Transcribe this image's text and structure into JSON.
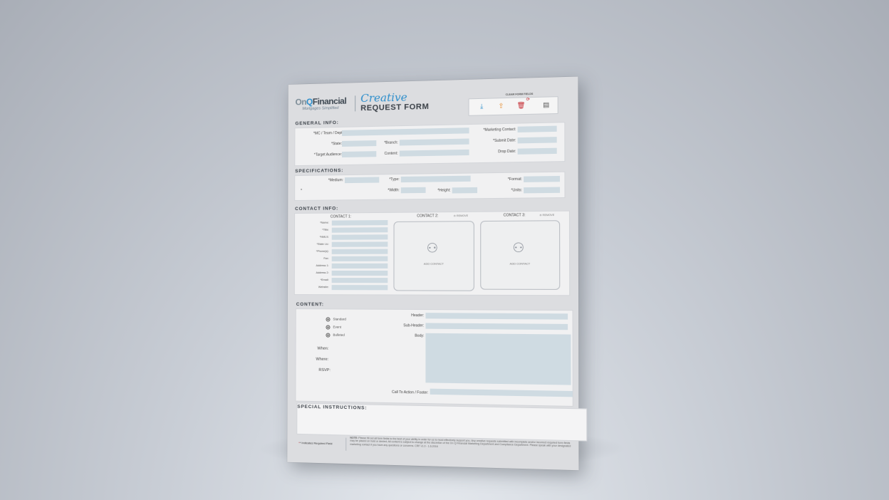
{
  "header": {
    "logo_on": "On",
    "logo_q": "Q",
    "logo_financial": "Financial",
    "logo_tagline": "Mortgages Simplified",
    "title_script": "Creative",
    "title_main": "REQUEST FORM",
    "clear_label": "CLEAR FORM FIELDS"
  },
  "toolbar": {
    "icons": [
      "download-icon",
      "upload-icon",
      "trash-icon",
      "refresh-icon",
      "document-icon"
    ]
  },
  "general": {
    "title": "GENERAL INFO:",
    "mc_label": "*MC / Team / Dept:",
    "state_label": "*State:",
    "branch_label": "*Branch:",
    "audience_label": "*Target Audience:",
    "content_label": "Content:",
    "marketing_label": "*Marketing Contact:",
    "submit_label": "*Submit Date:",
    "drop_label": "Drop Date:"
  },
  "spec": {
    "title": "SPECIFICATIONS:",
    "medium_label": "*Medium:",
    "type_label": "*Type:",
    "format_label": "*Format:",
    "star": "*",
    "width_label": "*Width:",
    "height_label": "*Height:",
    "units_label": "*Units:"
  },
  "contact": {
    "title": "CONTACT INFO:",
    "c1_title": "CONTACT 1:",
    "c2_title": "CONTACT 2:",
    "c3_title": "CONTACT 3:",
    "remove_label": "⊖ REMOVE",
    "add_label": "ADD CONTACT",
    "fields": [
      "*Name:",
      "*Title:",
      "*NMLS:",
      "*State Lic:",
      "*Phone(s):",
      "Fax:",
      "Address 1:",
      "Address 2:",
      "*Email:",
      "Website:"
    ]
  },
  "content": {
    "title": "CONTENT:",
    "radio_standard": "Standard",
    "radio_event": "Event",
    "radio_bulleted": "Bulleted",
    "when_label": "When:",
    "where_label": "Where:",
    "rsvp_label": "RSVP:",
    "header_label": "Header:",
    "subheader_label": "Sub-Header:",
    "body_label": "Body:",
    "cta_label": "Call To Action / Footer:"
  },
  "special": {
    "title": "SPECIAL INSTRUCTIONS:"
  },
  "footer": {
    "required_note": "* Indicates Required Field",
    "note_label": "NOTE:",
    "note_text": "Please fill out all form fields to the best of your ability in order for us to most effectively support you. Any creative requests submitted with incomplete and/or incorrect required form fields may be placed on hold or denied. All content is subject to change at the discretion of the On Q Financial Marketing Department and Compliance Department. Please speak with your designated marketing contact if you have any questions or concerns. CRF v1.0 - 1.6.2016"
  }
}
